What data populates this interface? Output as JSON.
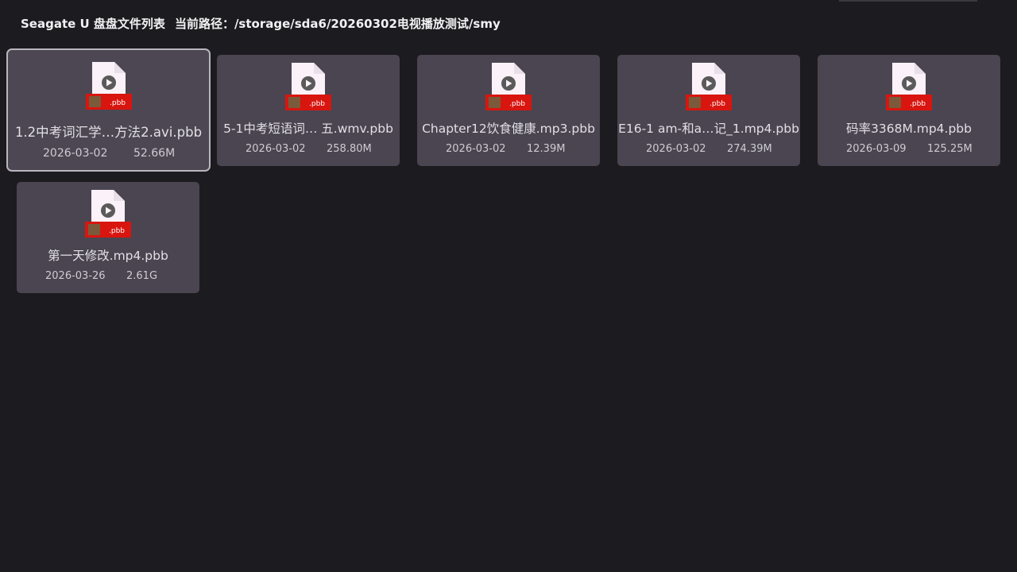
{
  "header": {
    "title": "Seagate U 盘盘文件列表",
    "path_label": "当前路径：/storage/sda6/20260302电视播放测试/smy"
  },
  "files": [
    {
      "name": "1.2中考词汇学…方法2.avi.pbb",
      "date": "2026-03-02",
      "size": "52.66M",
      "focused": true
    },
    {
      "name": "5-1中考短语词… 五.wmv.pbb",
      "date": "2026-03-02",
      "size": "258.80M"
    },
    {
      "name": "Chapter12饮食健康.mp3.pbb",
      "date": "2026-03-02",
      "size": "12.39M"
    },
    {
      "name": "E16-1 am-和a…记_1.mp4.pbb",
      "date": "2026-03-02",
      "size": "274.39M"
    },
    {
      "name": "码率3368M.mp4.pbb",
      "date": "2026-03-09",
      "size": "125.25M"
    },
    {
      "name": "第一天修改.mp4.pbb",
      "date": "2026-03-26",
      "size": "2.61G"
    }
  ],
  "icon": {
    "name": "video-file-icon",
    "badge_text": ".pbb",
    "badge_color": "#d9150f",
    "page_color": "#fbf1f8",
    "play_color": "#5a5a5a"
  }
}
